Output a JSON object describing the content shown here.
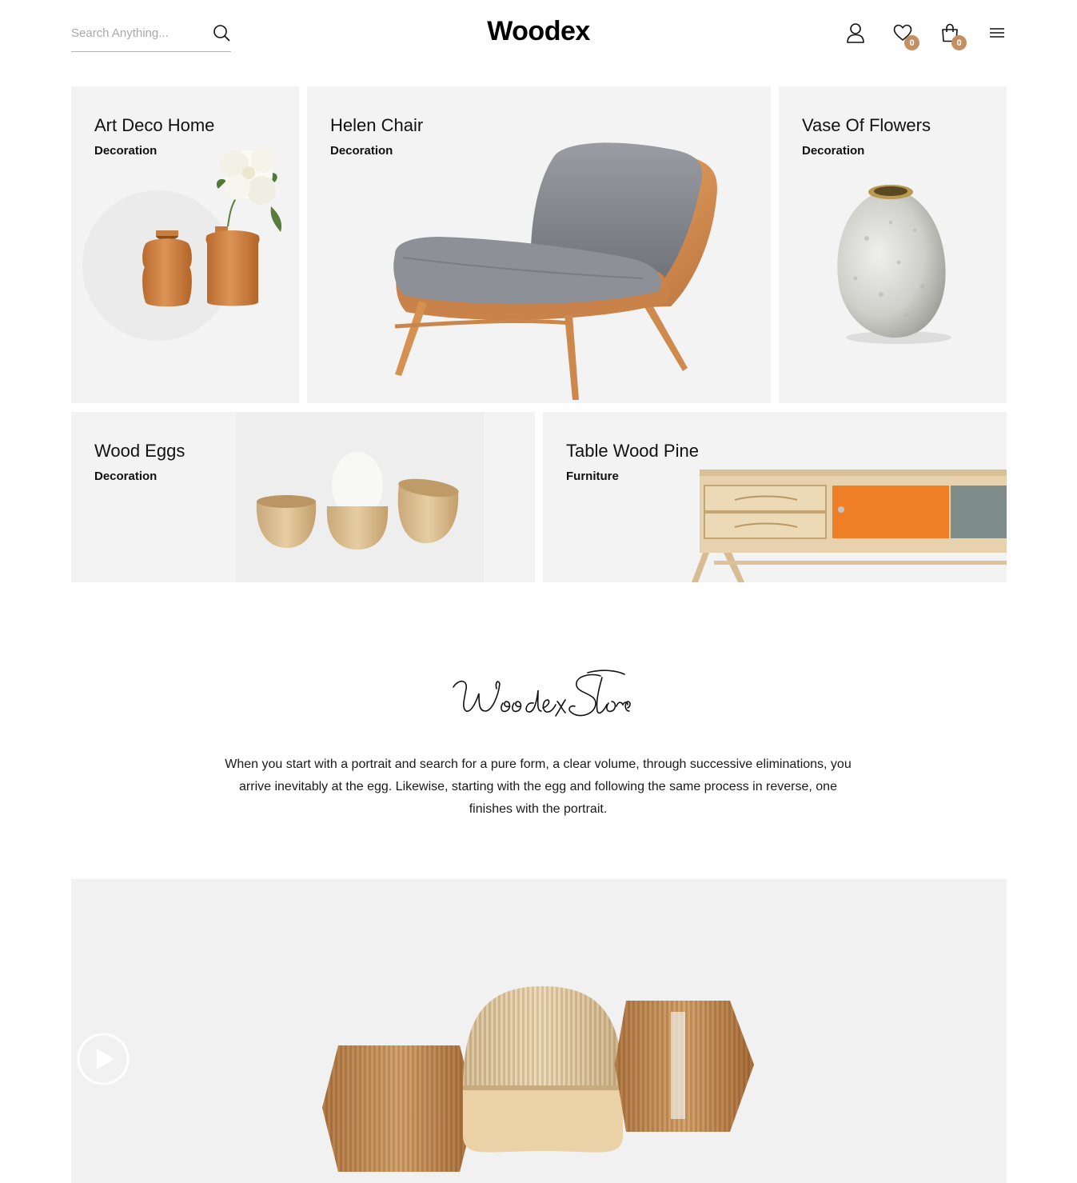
{
  "header": {
    "search_placeholder": "Search Anything...",
    "logo": "Woodex",
    "wishlist_count": "0",
    "cart_count": "0"
  },
  "icons": {
    "search": "search-icon",
    "account": "user-icon",
    "wishlist": "heart-icon",
    "cart": "shopping-bag-icon",
    "menu": "hamburger-menu-icon",
    "play": "play-icon"
  },
  "colors": {
    "accent": "#c49063",
    "tile_background": "#f3f3f3"
  },
  "tiles": [
    {
      "title": "Art Deco Home",
      "category": "Decoration"
    },
    {
      "title": "Helen Chair",
      "category": "Decoration"
    },
    {
      "title": "Vase Of Flowers",
      "category": "Decoration"
    },
    {
      "title": "Wood Eggs",
      "category": "Decoration"
    },
    {
      "title": "Table Wood Pine",
      "category": "Furniture"
    }
  ],
  "story": {
    "signature": "Woodex Store",
    "text": "When you start with a portrait and search for a pure form, a clear volume, through successive eliminations, you arrive inevitably at the egg. Likewise, starting with the egg and following the same process in reverse, one finishes with the portrait."
  }
}
